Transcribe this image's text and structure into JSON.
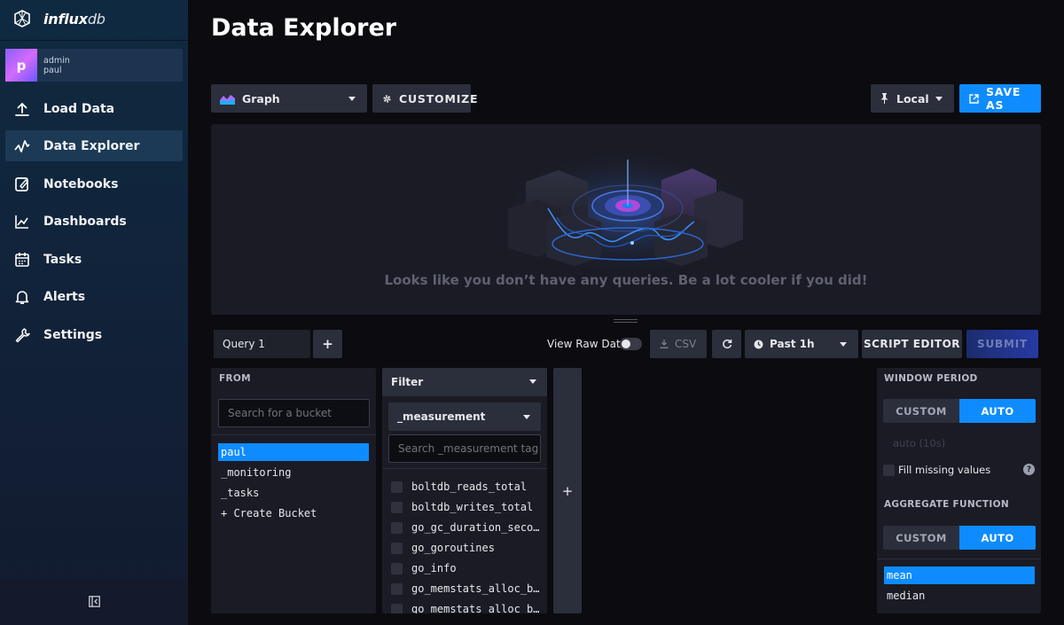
{
  "brand": {
    "name_bold": "influx",
    "name_light": "db"
  },
  "user": {
    "avatar_letter": "p",
    "role": "admin",
    "name": "paul"
  },
  "nav": {
    "items": [
      {
        "label": "Load Data",
        "icon": "upload-icon"
      },
      {
        "label": "Data Explorer",
        "icon": "graph-line-icon",
        "active": true
      },
      {
        "label": "Notebooks",
        "icon": "notebook-icon"
      },
      {
        "label": "Dashboards",
        "icon": "dashboard-icon"
      },
      {
        "label": "Tasks",
        "icon": "calendar-icon"
      },
      {
        "label": "Alerts",
        "icon": "bell-icon"
      },
      {
        "label": "Settings",
        "icon": "wrench-icon"
      }
    ]
  },
  "page": {
    "title": "Data Explorer"
  },
  "toolbar": {
    "vis_type": "Graph",
    "customize_label": "CUSTOMIZE",
    "timezone": "Local",
    "save_as_label": "SAVE AS"
  },
  "graph": {
    "empty_message": "Looks like you don’t have any queries. Be a lot cooler if you did!"
  },
  "query_bar": {
    "tab_label": "Query 1",
    "add_label": "+",
    "view_raw_label": "View Raw Data",
    "view_raw_on": false,
    "csv_label": "CSV",
    "time_range": "Past 1h",
    "script_editor_label": "SCRIPT EDITOR",
    "submit_label": "SUBMIT"
  },
  "from_panel": {
    "header": "FROM",
    "search_placeholder": "Search for a bucket",
    "buckets": [
      "paul",
      "_monitoring",
      "_tasks"
    ],
    "selected_bucket": "paul",
    "create_label": "+ Create Bucket"
  },
  "filter_panel": {
    "header": "Filter",
    "key": "_measurement",
    "search_placeholder": "Search _measurement tag",
    "values": [
      "boltdb_reads_total",
      "boltdb_writes_total",
      "go_gc_duration_seco…",
      "go_goroutines",
      "go_info",
      "go_memstats_alloc_b…",
      "go_memstats_alloc_b…"
    ]
  },
  "add_filter_label": "+",
  "window_panel": {
    "window_header": "WINDOW PERIOD",
    "custom_label": "CUSTOM",
    "auto_label": "AUTO",
    "auto_value": "auto (10s)",
    "fill_missing_label": "Fill missing values",
    "aggregate_header": "AGGREGATE FUNCTION",
    "functions": [
      "mean",
      "median"
    ],
    "selected_function": "mean"
  },
  "colors": {
    "accent": "#0e8cff",
    "panel": "#1a1b24",
    "background": "#0b0b10"
  }
}
